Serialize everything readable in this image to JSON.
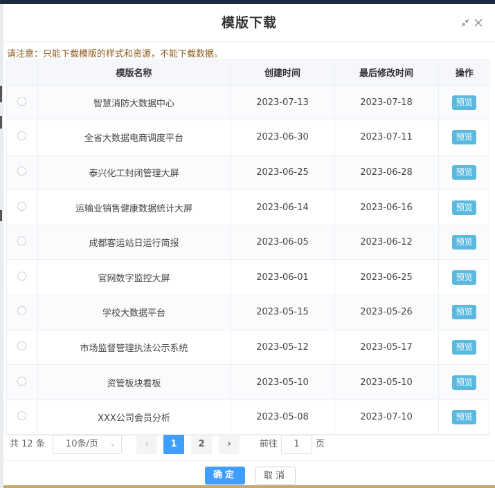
{
  "dialog": {
    "title": "模版下载",
    "icons": {
      "collapse": "collapse-icon",
      "close": "close-icon"
    },
    "notice": "请注意：只能下载模版的样式和资源，不能下载数据。"
  },
  "table": {
    "columns": [
      "",
      "模版名称",
      "创建时间",
      "最后修改时间",
      "操作"
    ],
    "preview_label": "预览",
    "rows": [
      {
        "name": "智慧消防大数据中心",
        "created": "2023-07-13",
        "modified": "2023-07-18"
      },
      {
        "name": "全省大数据电商调度平台",
        "created": "2023-06-30",
        "modified": "2023-07-11"
      },
      {
        "name": "泰兴化工封闭管理大屏",
        "created": "2023-06-25",
        "modified": "2023-06-28"
      },
      {
        "name": "运输业销售健康数据统计大屏",
        "created": "2023-06-14",
        "modified": "2023-06-16"
      },
      {
        "name": "成都客运站日运行简报",
        "created": "2023-06-05",
        "modified": "2023-06-12"
      },
      {
        "name": "官网数字监控大屏",
        "created": "2023-06-01",
        "modified": "2023-06-25"
      },
      {
        "name": "学校大数据平台",
        "created": "2023-05-15",
        "modified": "2023-05-26"
      },
      {
        "name": "市场监督管理执法公示系统",
        "created": "2023-05-12",
        "modified": "2023-05-17"
      },
      {
        "name": "资管板块看板",
        "created": "2023-05-10",
        "modified": "2023-05-10"
      },
      {
        "name": "XXX公司会员分析",
        "created": "2023-05-08",
        "modified": "2023-07-10"
      }
    ]
  },
  "pagination": {
    "total": "共 12 条",
    "page_size": "10条/页",
    "prev": "‹",
    "next": "›",
    "pages": [
      "1",
      "2"
    ],
    "current": "1",
    "goto_label": "前往",
    "goto_value": "1",
    "goto_suffix": "页"
  },
  "footer": {
    "ok": "确定",
    "cancel": "取消"
  },
  "colors": {
    "primary": "#409eff",
    "preview": "#5bb8de",
    "notice": "#8a5a1c"
  }
}
